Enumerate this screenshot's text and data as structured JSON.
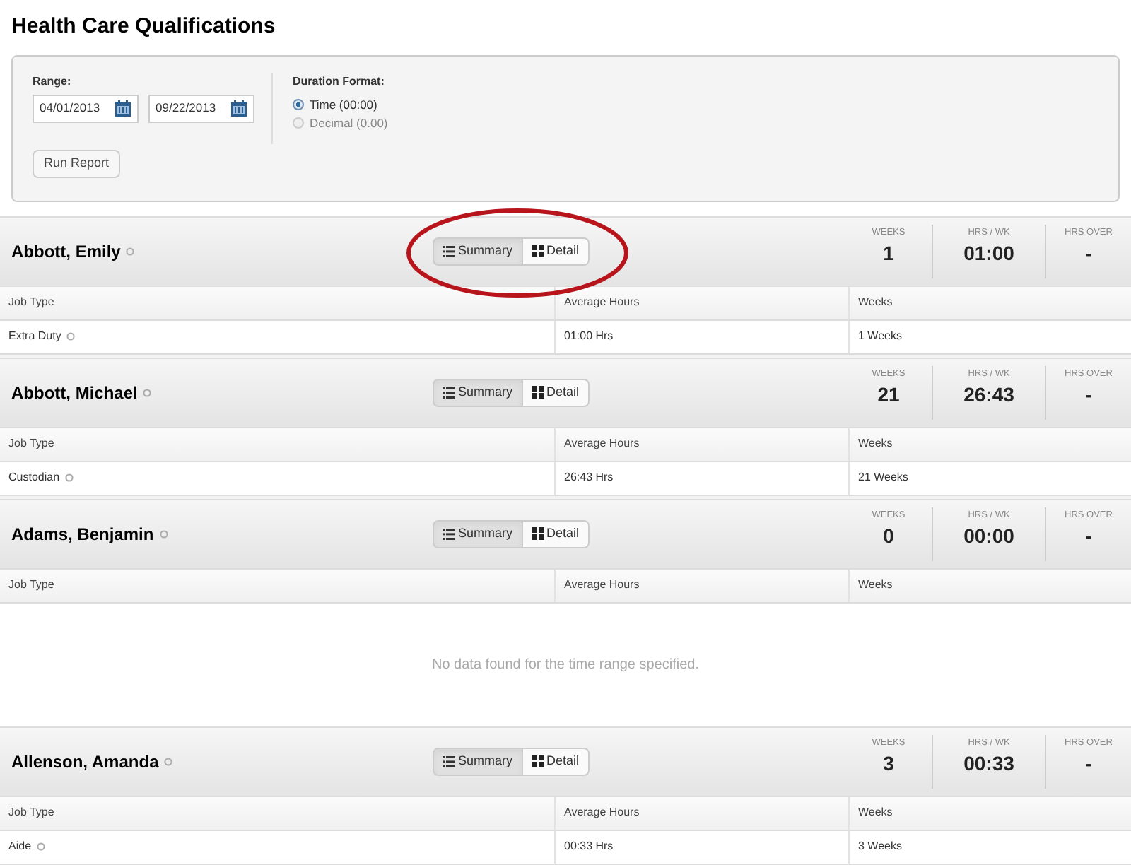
{
  "title": "Health Care Qualifications",
  "filters": {
    "range_label": "Range:",
    "start_date": "04/01/2013",
    "end_date": "09/22/2013",
    "duration_label": "Duration Format:",
    "formats": [
      {
        "label": "Time (00:00)",
        "selected": true
      },
      {
        "label": "Decimal (0.00)",
        "selected": false
      }
    ],
    "run_button": "Run Report"
  },
  "employees": [
    {
      "name": "Abbott, Emily",
      "circled": true,
      "views": [
        {
          "label": "Summary",
          "selected": true
        },
        {
          "label": "Detail",
          "selected": false
        }
      ],
      "stats": [
        {
          "label": "WEEKS",
          "value": "1"
        },
        {
          "label": "HRS / WK",
          "value": "01:00"
        },
        {
          "label": "HRS OVER",
          "value": "-"
        }
      ],
      "columns": [
        "Job Type",
        "Average Hours",
        "Weeks"
      ],
      "rows": [
        [
          "Extra Duty",
          "01:00 Hrs",
          "1 Weeks"
        ]
      ]
    },
    {
      "name": "Abbott, Michael",
      "circled": false,
      "views": [
        {
          "label": "Summary",
          "selected": true
        },
        {
          "label": "Detail",
          "selected": false
        }
      ],
      "stats": [
        {
          "label": "WEEKS",
          "value": "21"
        },
        {
          "label": "HRS / WK",
          "value": "26:43"
        },
        {
          "label": "HRS OVER",
          "value": "-"
        }
      ],
      "columns": [
        "Job Type",
        "Average Hours",
        "Weeks"
      ],
      "rows": [
        [
          "Custodian",
          "26:43 Hrs",
          "21 Weeks"
        ]
      ]
    },
    {
      "name": "Adams, Benjamin",
      "circled": false,
      "views": [
        {
          "label": "Summary",
          "selected": true
        },
        {
          "label": "Detail",
          "selected": false
        }
      ],
      "stats": [
        {
          "label": "WEEKS",
          "value": "0"
        },
        {
          "label": "HRS / WK",
          "value": "00:00"
        },
        {
          "label": "HRS OVER",
          "value": "-"
        }
      ],
      "columns": [
        "Job Type",
        "Average Hours",
        "Weeks"
      ],
      "empty_message": "No data found for the time range specified."
    },
    {
      "name": "Allenson, Amanda",
      "circled": false,
      "views": [
        {
          "label": "Summary",
          "selected": true
        },
        {
          "label": "Detail",
          "selected": false
        }
      ],
      "stats": [
        {
          "label": "WEEKS",
          "value": "3"
        },
        {
          "label": "HRS / WK",
          "value": "00:33"
        },
        {
          "label": "HRS OVER",
          "value": "-"
        }
      ],
      "columns": [
        "Job Type",
        "Average Hours",
        "Weeks"
      ],
      "rows": [
        [
          "Aide",
          "00:33 Hrs",
          "3 Weeks"
        ]
      ]
    }
  ]
}
